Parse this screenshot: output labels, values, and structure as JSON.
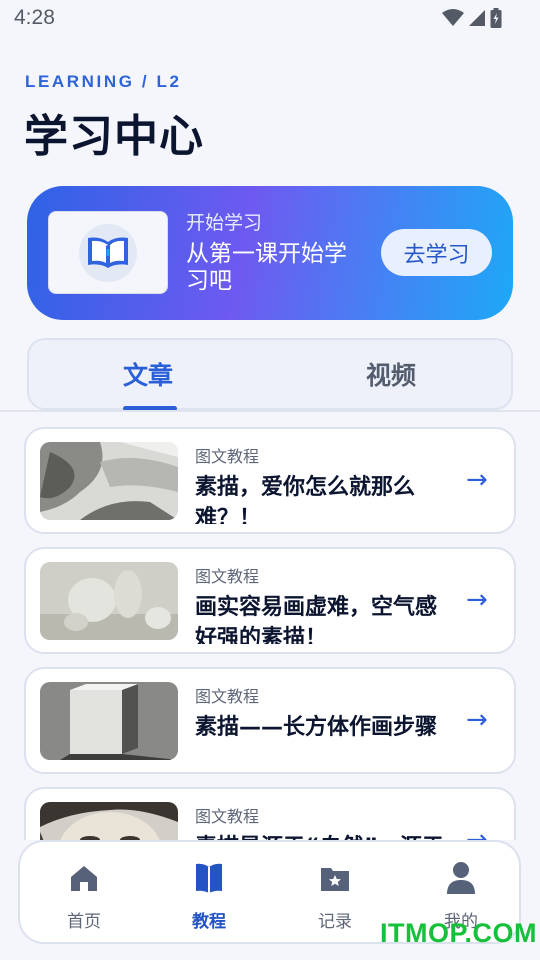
{
  "status_bar": {
    "time": "4:28"
  },
  "header": {
    "kicker": "LEARNING / L2",
    "title": "学习中心"
  },
  "hero": {
    "kicker": "开始学习",
    "subtitle": "从第一课开始学习吧",
    "button_label": "去学习"
  },
  "tabs": [
    {
      "label": "文章",
      "active": true
    },
    {
      "label": "视频",
      "active": false
    }
  ],
  "articles": [
    {
      "tag": "图文教程",
      "title": "素描，爱你怎么就那么难？！"
    },
    {
      "tag": "图文教程",
      "title": "画实容易画虚难，空气感好强的素描！"
    },
    {
      "tag": "图文教程",
      "title": "素描——长方体作画步骤"
    },
    {
      "tag": "图文教程",
      "title": "素描是源于“自然”，源于"
    }
  ],
  "bottom_nav": [
    {
      "label": "首页",
      "icon": "home-icon",
      "active": false
    },
    {
      "label": "教程",
      "icon": "book-icon",
      "active": true
    },
    {
      "label": "记录",
      "icon": "folder-star-icon",
      "active": false
    },
    {
      "label": "我的",
      "icon": "user-icon",
      "active": false
    }
  ],
  "watermark": "ITMOP.COM",
  "colors": {
    "accent": "#2a5fd8",
    "gradient_start": "#2e63e6",
    "gradient_mid": "#6e5af0",
    "gradient_end": "#1da9f7"
  }
}
